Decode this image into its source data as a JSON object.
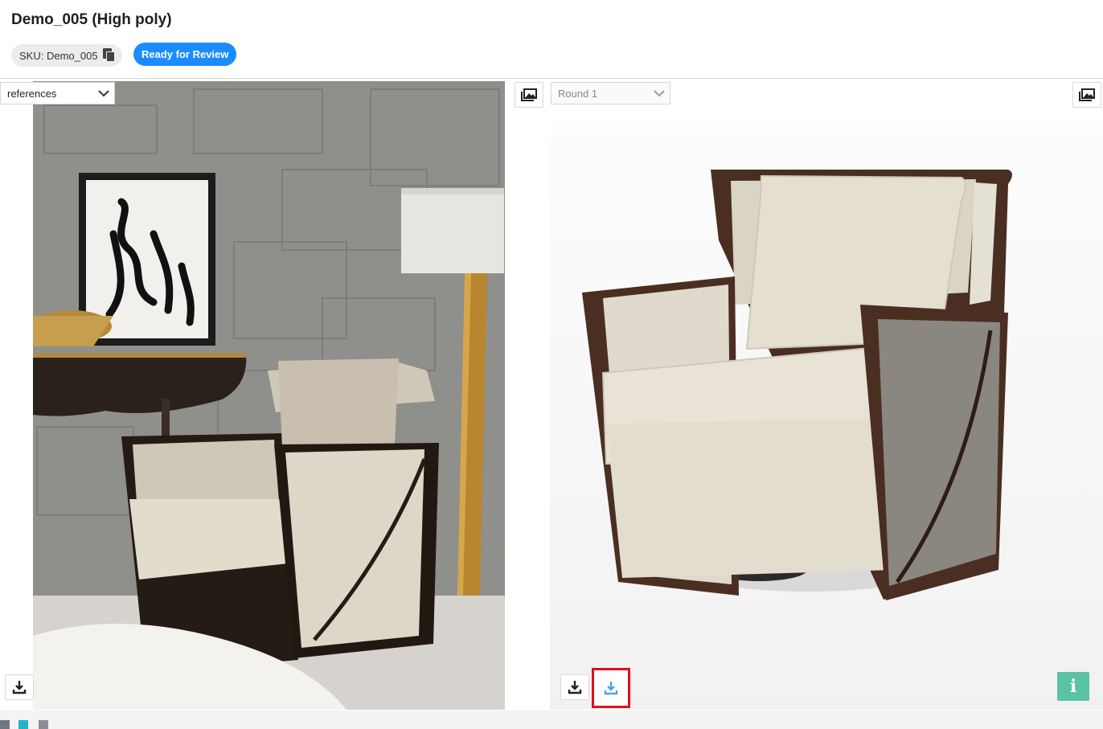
{
  "header": {
    "title": "Demo_005 (High poly)",
    "sku_label": "SKU: Demo_005",
    "status_badge": "Ready for Review"
  },
  "left_panel": {
    "select_value": "references",
    "image_alt": "Reference photo: upholstered swivel armchair with dark wood frame in a styled room"
  },
  "right_panel": {
    "select_value": "Round 1",
    "image_alt": "3D render of the armchair on white background"
  },
  "icons": {
    "gallery": "gallery-icon",
    "download": "download-icon",
    "info": "info-icon",
    "copy": "copy-icon",
    "chevron": "chevron-down-icon"
  },
  "info_glyph": "i",
  "colors": {
    "accent": "#1a8cff",
    "info": "#5bc2a3",
    "highlight": "#e0101e",
    "download_active": "#4aa3ea"
  }
}
